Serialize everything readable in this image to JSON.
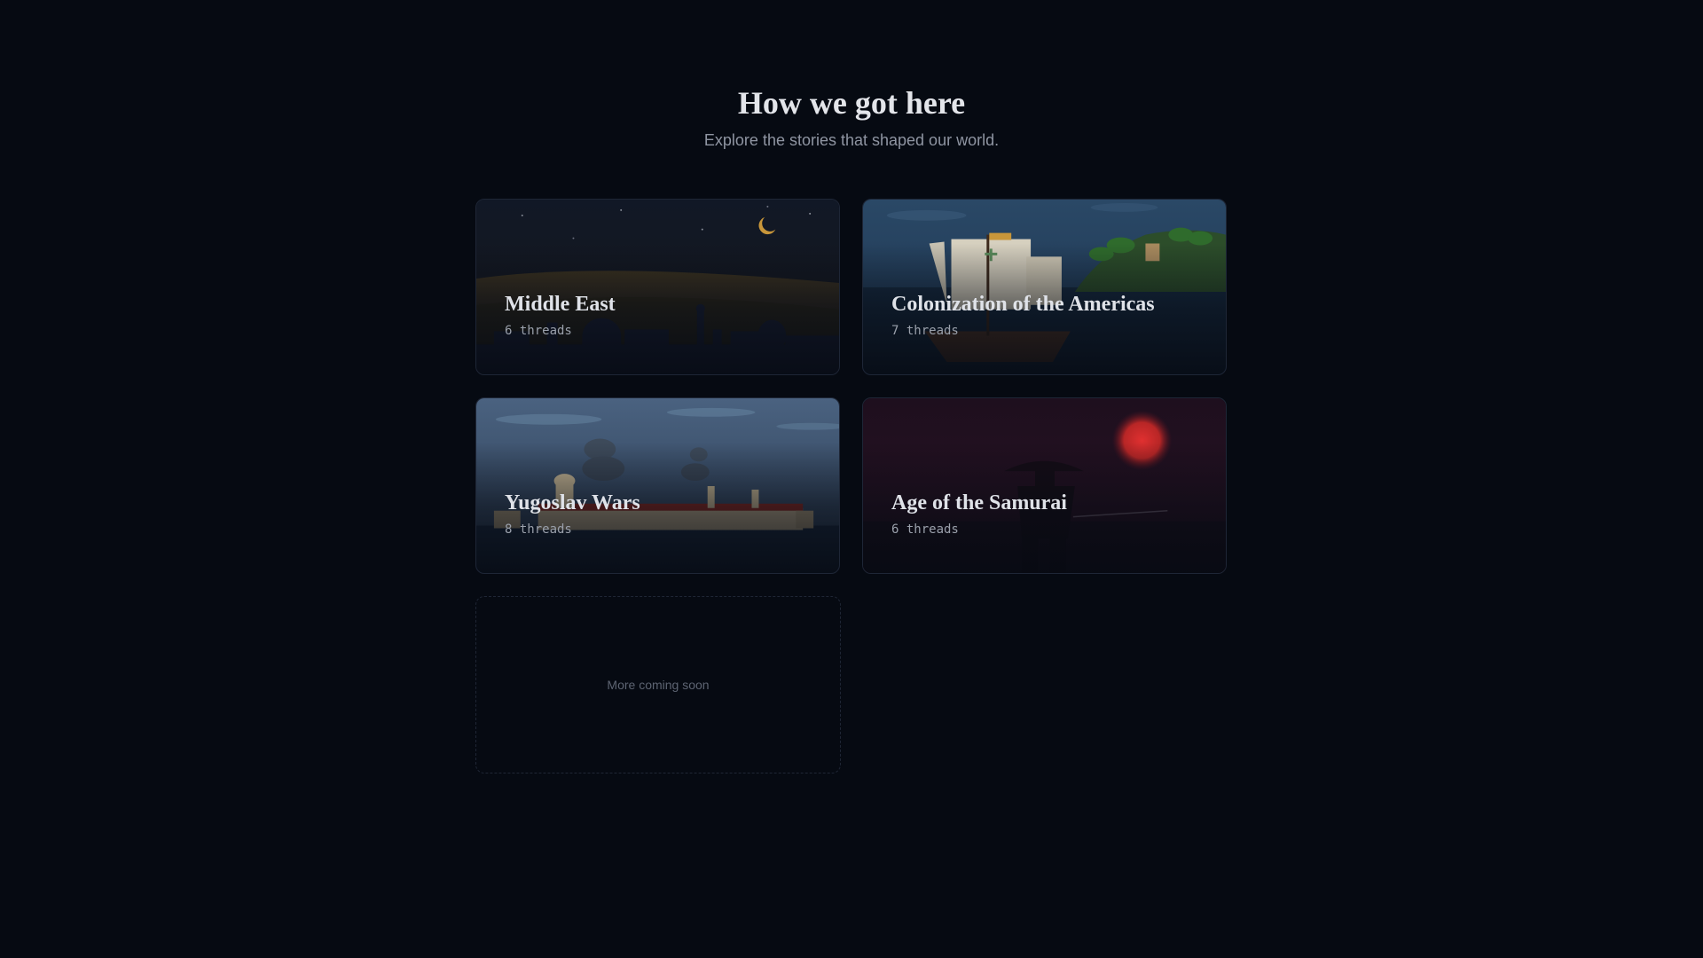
{
  "header": {
    "title": "How we got here",
    "subtitle": "Explore the stories that shaped our world."
  },
  "cards": [
    {
      "title": "Middle East",
      "count": "6 threads",
      "scene": "desert-city-night"
    },
    {
      "title": "Colonization of the Americas",
      "count": "7 threads",
      "scene": "caravel-coast"
    },
    {
      "title": "Yugoslav Wars",
      "count": "8 threads",
      "scene": "fortress-smoke"
    },
    {
      "title": "Age of the Samurai",
      "count": "6 threads",
      "scene": "samurai-red-sun"
    }
  ],
  "placeholder": {
    "label": "More coming soon"
  },
  "colors": {
    "background": "#060a12",
    "card_border": "#1e2636",
    "title_text": "#e3e5ea",
    "muted_text": "#8f95a2"
  }
}
